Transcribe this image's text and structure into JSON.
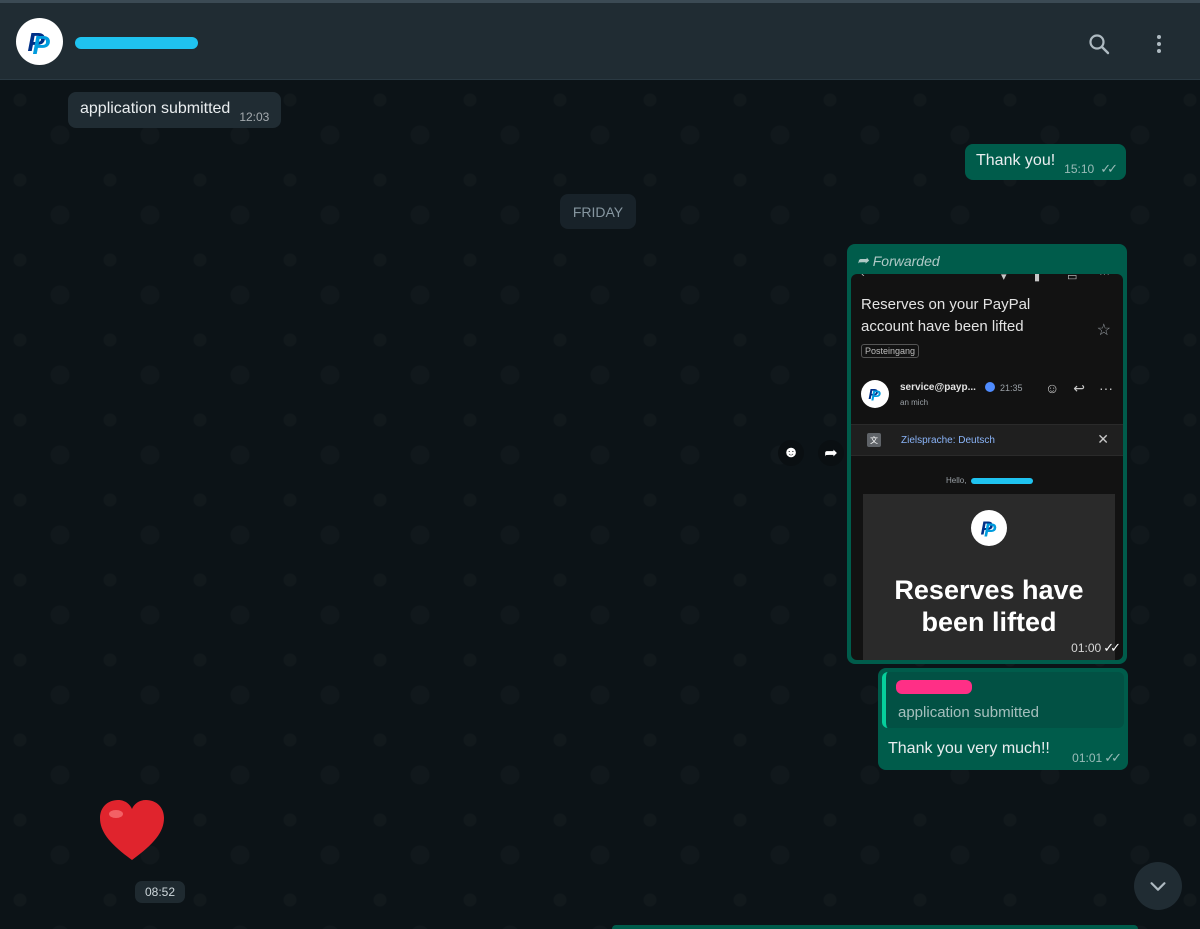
{
  "header": {
    "contact_name": "[redacted]",
    "avatar_icon": "paypal-logo-icon",
    "search_icon": "search-icon",
    "menu_icon": "kebab-menu-icon"
  },
  "messages": {
    "msg1": {
      "text": "application submitted",
      "time": "12:03"
    },
    "msg2": {
      "text": "Thank you!",
      "time": "15:10"
    },
    "date_divider": "FRIDAY",
    "forwarded": {
      "label": "Forwarded",
      "time": "01:00",
      "email": {
        "subject": "Reserves on your PayPal account have been lifted",
        "folder": "Posteingang",
        "sender": "service@payp...",
        "sent_time": "21:35",
        "recipient": "an mich",
        "translate_text": "Zielsprache: Deutsch",
        "hello": "Hello,",
        "hero_title": "Reserves have been lifted"
      }
    },
    "reply": {
      "quoted_text": "application submitted",
      "text": "Thank you very much!!",
      "time": "01:01"
    },
    "heart": {
      "emoji": "❤️",
      "time": "08:52"
    }
  },
  "colors": {
    "header_bg": "#202c33",
    "chat_bg": "#0c1317",
    "incoming_bubble": "#202c33",
    "outgoing_bubble": "#005c4b",
    "accent": "#06cf9c",
    "redaction": "#1fc3f0"
  }
}
